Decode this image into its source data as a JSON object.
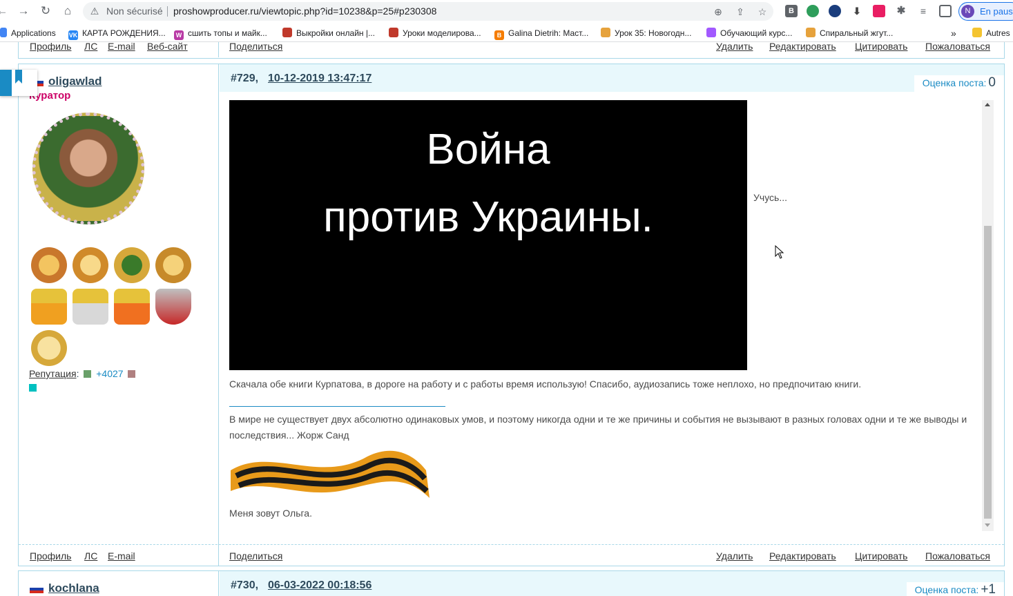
{
  "browser": {
    "status": "Non sécurisé",
    "url": "proshowproducer.ru/viewtopic.php?id=10238&p=25#p230308",
    "profile_initial": "N",
    "profile_status": "En pause"
  },
  "bookmarks": {
    "items": [
      {
        "label": "Applications",
        "color": "#4285f4"
      },
      {
        "label": "КАРТА РОЖДЕНИЯ...",
        "color": "#2787f5"
      },
      {
        "label": "сшить топы и майк...",
        "color": "#b93aa5"
      },
      {
        "label": "Выкройки онлайн |...",
        "color": "#c0392b"
      },
      {
        "label": "Уроки моделирова...",
        "color": "#c0392b"
      },
      {
        "label": "Galina Dietrih: Маст...",
        "color": "#f57c00"
      },
      {
        "label": "Урок 35: Новогодн...",
        "color": "#e6a23c"
      },
      {
        "label": "Обучающий курс...",
        "color": "#a259ff"
      },
      {
        "label": "Спиральный жгут...",
        "color": "#e6a23c"
      }
    ],
    "more": "»",
    "other": "Autres"
  },
  "prev_footer": {
    "links_left": [
      "Профиль",
      "ЛС",
      "E-mail",
      "Веб-сайт"
    ],
    "share": "Поделиться",
    "links_right": [
      "Удалить",
      "Редактировать",
      "Цитировать",
      "Пожаловаться"
    ]
  },
  "post": {
    "number": "#729,",
    "date": "10-12-2019 13:47:17",
    "rating_label": "Оценка поста:",
    "rating_value": "0",
    "author": "oligawlad",
    "role": "Куратор",
    "reputation_label": "Репутация",
    "reputation_value": "+4027",
    "video_line1": "Война",
    "video_line2": "против Украины.",
    "side_text": "Учусь...",
    "body": "Скачала обе книги Курпатова, в дороге на работу и с работы время использую! Спасибо, аудиозапись тоже неплохо, но предпочитаю книги.",
    "signature": "В мире не существует двух абсолютно одинаковых умов, и поэтому никогда одни и те же причины и события не вызывают в разных головах одни и те же выводы и последствия...  Жорж Санд",
    "name_line": "Меня зовут Ольга.",
    "footer_left": [
      "Профиль",
      "ЛС",
      "E-mail"
    ],
    "share": "Поделиться",
    "footer_right": [
      "Удалить",
      "Редактировать",
      "Цитировать",
      "Пожаловаться"
    ]
  },
  "next_post": {
    "number": "#730,",
    "date": "06-03-2022 00:18:56",
    "rating_label": "Оценка поста:",
    "rating_value": "+1",
    "author": "kochlana"
  },
  "colors": {
    "frame": "#a8d8e8",
    "header_bg": "#e8f8fc",
    "accent": "#1a8bc4",
    "role": "#cc0066"
  }
}
